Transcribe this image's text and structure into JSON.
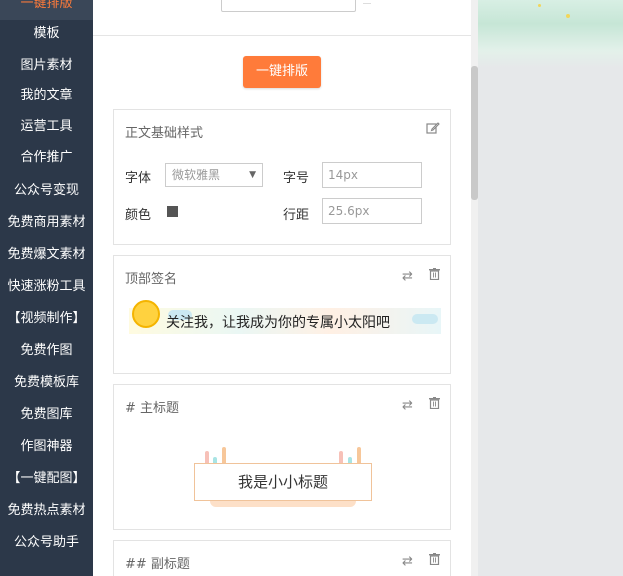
{
  "sidebar": {
    "items": [
      {
        "label": "一键排版",
        "active": true
      },
      {
        "label": "模板"
      },
      {
        "label": "图片素材"
      },
      {
        "label": "我的文章"
      },
      {
        "label": "运营工具"
      },
      {
        "label": "合作推广"
      },
      {
        "label": "公众号变现"
      },
      {
        "label": "免费商用素材"
      },
      {
        "label": "免费爆文素材"
      },
      {
        "label": "快速涨粉工具"
      },
      {
        "label": "【视频制作】"
      },
      {
        "label": "免费作图"
      },
      {
        "label": "免费模板库"
      },
      {
        "label": "免费图库"
      },
      {
        "label": "作图神器"
      },
      {
        "label": "【一键配图】"
      },
      {
        "label": "免费热点素材"
      },
      {
        "label": "公众号助手"
      }
    ]
  },
  "main": {
    "primary_button": "一键排版",
    "base_style": {
      "title": "正文基础样式",
      "font_label": "字体",
      "font_value": "微软雅黑",
      "size_label": "字号",
      "size_value": "14px",
      "color_label": "颜色",
      "color_value": "#555555",
      "line_label": "行距",
      "line_value": "25.6px"
    },
    "top_signature": {
      "title": "顶部签名",
      "text": "关注我，让我成为你的专属小太阳吧"
    },
    "main_title": {
      "title": "# 主标题",
      "sample": "我是小小标题"
    },
    "sub_title": {
      "title": "## 副标题"
    }
  },
  "colors": {
    "accent": "#ff7b3a",
    "sidebar_bg": "#2c3849"
  }
}
